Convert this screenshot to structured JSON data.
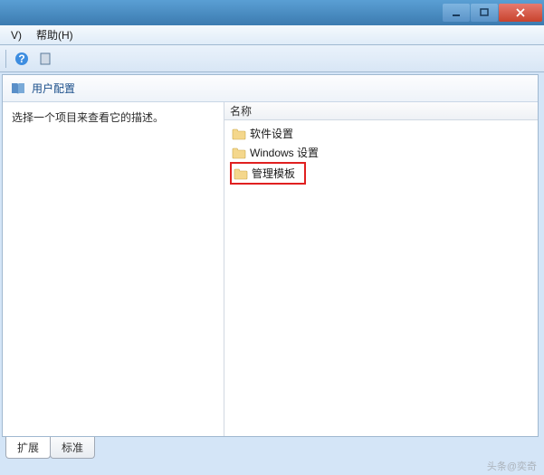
{
  "menu": {
    "view": "V)",
    "help": "帮助(H)"
  },
  "header": {
    "title": "用户配置"
  },
  "left_pane": {
    "prompt": "选择一个项目来查看它的描述。"
  },
  "columns": {
    "name": "名称"
  },
  "items": [
    {
      "label": "软件设置",
      "highlighted": false
    },
    {
      "label": "Windows 设置",
      "highlighted": false
    },
    {
      "label": "管理模板",
      "highlighted": true
    }
  ],
  "tabs": {
    "extended": "扩展",
    "standard": "标准"
  },
  "watermark": "头条@奕奇"
}
